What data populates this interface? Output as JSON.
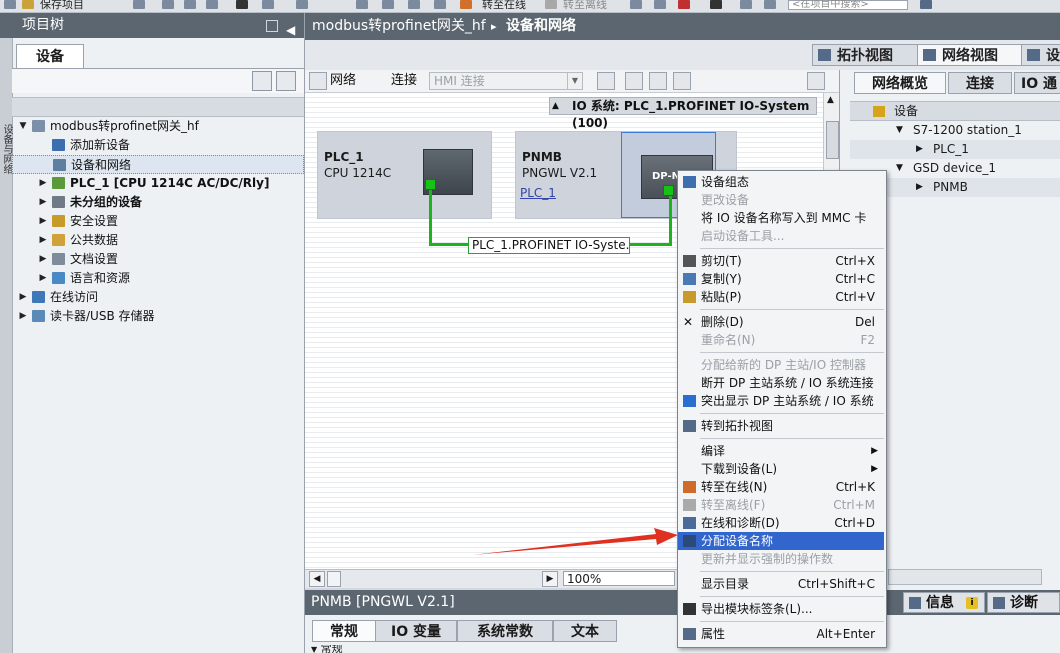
{
  "toolbar": {
    "save_project": "保存项目",
    "go_online": "转至在线",
    "go_offline": "转至离线",
    "search_placeholder": "<在项目中搜索>"
  },
  "left": {
    "title": "项目树",
    "vertical_label": "设备与网络",
    "tab": "设备",
    "tree": [
      {
        "label": "modbus转profinet网关_hf",
        "expand": "▼",
        "level": 0,
        "icon": "project-icon"
      },
      {
        "label": "添加新设备",
        "expand": "",
        "level": 1,
        "icon": "add-device-icon"
      },
      {
        "label": "设备和网络",
        "expand": "",
        "level": 1,
        "icon": "network-icon",
        "selected": true
      },
      {
        "label": "PLC_1 [CPU 1214C AC/DC/Rly]",
        "expand": "▶",
        "level": 1,
        "icon": "plc-icon",
        "bold": true
      },
      {
        "label": "未分组的设备",
        "expand": "▶",
        "level": 1,
        "icon": "device-group-icon",
        "bold": true
      },
      {
        "label": "安全设置",
        "expand": "▶",
        "level": 1,
        "icon": "security-icon"
      },
      {
        "label": "公共数据",
        "expand": "▶",
        "level": 1,
        "icon": "folder-icon"
      },
      {
        "label": "文档设置",
        "expand": "▶",
        "level": 1,
        "icon": "document-icon"
      },
      {
        "label": "语言和资源",
        "expand": "▶",
        "level": 1,
        "icon": "language-icon"
      },
      {
        "label": "在线访问",
        "expand": "▶",
        "level": 0,
        "icon": "online-access-icon"
      },
      {
        "label": "读卡器/USB 存储器",
        "expand": "▶",
        "level": 0,
        "icon": "card-reader-icon"
      }
    ]
  },
  "breadcrumb": {
    "project": "modbus转profinet网关_hf",
    "sep": "▸",
    "page": "设备和网络"
  },
  "view_tabs": [
    "拓扑视图",
    "网络视图",
    "设"
  ],
  "net_toolbar": {
    "network": "网络",
    "connection": "连接",
    "hmi_select": "HMI 连接"
  },
  "canvas": {
    "io_system": "IO 系统: PLC_1.PROFINET IO-System (100)",
    "plc": {
      "name": "PLC_1",
      "type": "CPU 1214C"
    },
    "pnmb": {
      "name": "PNMB",
      "type": "PNGWL V2.1",
      "link": "PLC_1",
      "module": "DP-N"
    },
    "network_label": "PLC_1.PROFINET IO-Syste...",
    "zoom": "100%"
  },
  "overview": {
    "tabs": [
      "网络概览",
      "连接",
      "IO 通"
    ],
    "header": "设备",
    "rows": [
      {
        "label": "S7-1200 station_1",
        "expand": "▼",
        "level": 1
      },
      {
        "label": "PLC_1",
        "expand": "▶",
        "level": 2
      },
      {
        "label": "GSD device_1",
        "expand": "▼",
        "level": 1
      },
      {
        "label": "PNMB",
        "expand": "▶",
        "level": 2
      }
    ]
  },
  "inspector": {
    "title": "PNMB [PNGWL V2.1]",
    "tabs": [
      "常规",
      "IO 变量",
      "系统常数",
      "文本"
    ],
    "info": "信息",
    "diag": "诊断",
    "general_label": "常规"
  },
  "menu": {
    "items": [
      {
        "label": "设备组态",
        "shortcut": "",
        "icon": "device-config-icon",
        "disabled": false
      },
      {
        "label": "更改设备",
        "shortcut": "",
        "icon": "",
        "disabled": true
      },
      {
        "label": "将 IO 设备名称写入到 MMC 卡",
        "shortcut": "",
        "icon": "",
        "disabled": false
      },
      {
        "label": "启动设备工具...",
        "shortcut": "",
        "icon": "",
        "disabled": true
      },
      {
        "sep": true
      },
      {
        "label": "剪切(T)",
        "shortcut": "Ctrl+X",
        "icon": "cut-icon",
        "disabled": false
      },
      {
        "label": "复制(Y)",
        "shortcut": "Ctrl+C",
        "icon": "copy-icon",
        "disabled": false
      },
      {
        "label": "粘贴(P)",
        "shortcut": "Ctrl+V",
        "icon": "paste-icon",
        "disabled": false
      },
      {
        "sep": true
      },
      {
        "label": "删除(D)",
        "shortcut": "Del",
        "icon": "delete-icon",
        "disabled": false
      },
      {
        "label": "重命名(N)",
        "shortcut": "F2",
        "icon": "",
        "disabled": true
      },
      {
        "sep": true
      },
      {
        "label": "分配给新的 DP 主站/IO 控制器",
        "shortcut": "",
        "icon": "",
        "disabled": true
      },
      {
        "label": "断开 DP 主站系统 / IO 系统连接",
        "shortcut": "",
        "icon": "",
        "disabled": false
      },
      {
        "label": "突出显示 DP 主站系统 / IO 系统",
        "shortcut": "",
        "icon": "checkbox-icon",
        "disabled": false
      },
      {
        "sep": true
      },
      {
        "label": "转到拓扑视图",
        "shortcut": "",
        "icon": "topology-icon",
        "disabled": false
      },
      {
        "sep": true
      },
      {
        "label": "编译",
        "shortcut": "",
        "icon": "",
        "disabled": false,
        "submenu": true
      },
      {
        "label": "下载到设备(L)",
        "shortcut": "",
        "icon": "",
        "disabled": false,
        "submenu": true
      },
      {
        "label": "转至在线(N)",
        "shortcut": "Ctrl+K",
        "icon": "go-online-icon",
        "disabled": false
      },
      {
        "label": "转至离线(F)",
        "shortcut": "Ctrl+M",
        "icon": "go-offline-icon",
        "disabled": true
      },
      {
        "label": "在线和诊断(D)",
        "shortcut": "Ctrl+D",
        "icon": "diagnostics-icon",
        "disabled": false
      },
      {
        "label": "分配设备名称",
        "shortcut": "",
        "icon": "assign-name-icon",
        "disabled": false,
        "highlight": true
      },
      {
        "label": "更新并显示强制的操作数",
        "shortcut": "",
        "icon": "",
        "disabled": true
      },
      {
        "sep": true
      },
      {
        "label": "显示目录",
        "shortcut": "Ctrl+Shift+C",
        "icon": "",
        "disabled": false
      },
      {
        "sep": true
      },
      {
        "label": "导出模块标签条(L)...",
        "shortcut": "",
        "icon": "export-icon",
        "disabled": false
      },
      {
        "sep": true
      },
      {
        "label": "属性",
        "shortcut": "Alt+Enter",
        "icon": "properties-icon",
        "disabled": false
      }
    ]
  },
  "colors": {
    "accent": "#3366cc",
    "title_bar": "#5c6670",
    "profinet": "#1db31d",
    "arrow": "#e03020"
  }
}
